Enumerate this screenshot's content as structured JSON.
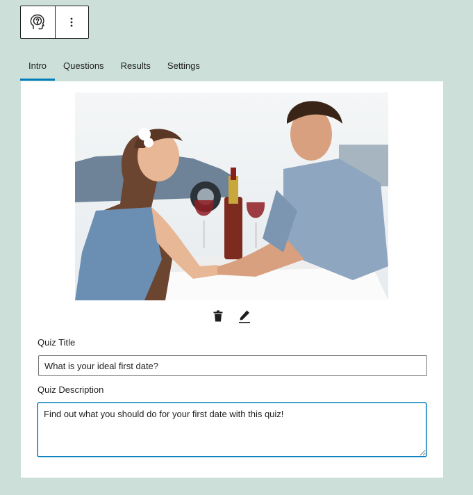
{
  "toolbar": {
    "block_icon": "quiz-head-question-icon",
    "options_icon": "more-vertical-icon"
  },
  "tabs": [
    {
      "label": "Intro",
      "active": true
    },
    {
      "label": "Questions",
      "active": false
    },
    {
      "label": "Results",
      "active": false
    },
    {
      "label": "Settings",
      "active": false
    }
  ],
  "intro": {
    "image_icons": [
      "trash-icon",
      "pencil-icon"
    ],
    "quiz_title_label": "Quiz Title",
    "quiz_title_value": "What is your ideal first date?",
    "quiz_description_label": "Quiz Description",
    "quiz_description_value": "Find out what you should do for your first date with this quiz!"
  },
  "colors": {
    "background": "#cce0d9",
    "accent": "#007cba",
    "panel": "#ffffff",
    "text": "#1e1e1e"
  }
}
